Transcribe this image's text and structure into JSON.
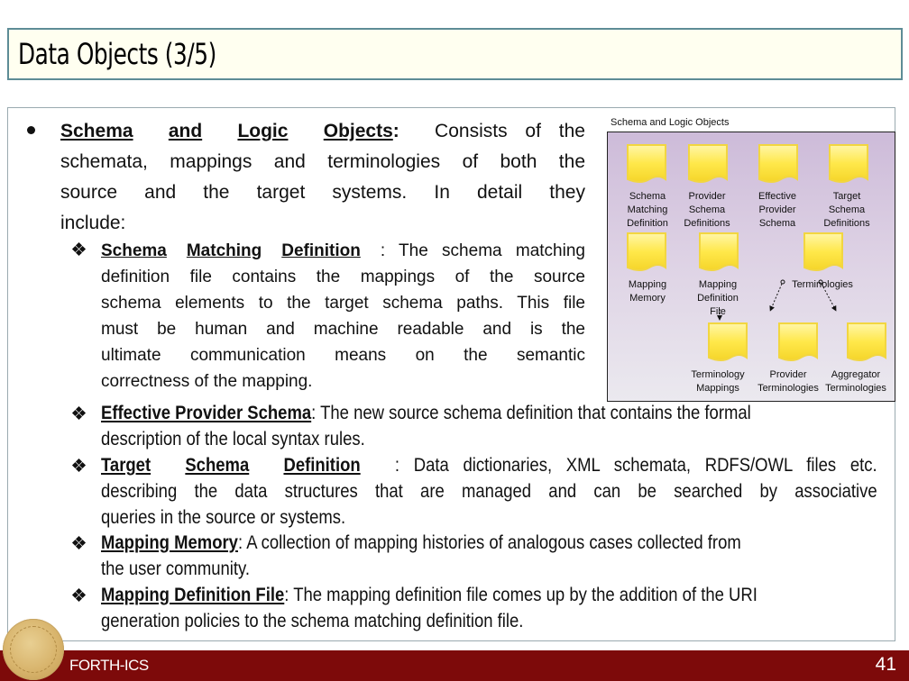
{
  "slide": {
    "title": "Data Objects (3/5)",
    "footer_org": "FORTH-ICS",
    "page_number": "41"
  },
  "main_bullet": {
    "term_words": [
      "Schema",
      "and",
      "Logic",
      "Objects"
    ],
    "colon": ":",
    "lines": [
      "Consists of the",
      "schemata, mappings and terminologies of both the",
      "source and the target systems. In detail they",
      "include:"
    ]
  },
  "sub_bullets": [
    {
      "term_words": [
        "Schema",
        "Matching",
        "Definition"
      ],
      "lines": [
        ": The schema matching",
        "definition file contains the mappings of the source",
        "schema elements to the target schema paths.  This file",
        "must be human and machine readable and is the",
        "ultimate communication means on the semantic",
        "correctness of the mapping."
      ]
    },
    {
      "term_words": [
        "Effective Provider Schema"
      ],
      "lines": [
        ": The new source schema definition that contains the formal",
        "description of the local syntax rules."
      ]
    },
    {
      "term_words": [
        "Target",
        "Schema",
        "Definition"
      ],
      "lines": [
        ": Data dictionaries, XML schemata, RDFS/OWL files etc.",
        "describing the data structures that are managed and can be searched by associative",
        "queries in the source or systems."
      ]
    },
    {
      "term_words": [
        "Mapping Memory"
      ],
      "lines": [
        ": A collection of mapping histories of analogous cases collected from",
        "the user community."
      ]
    },
    {
      "term_words": [
        "Mapping Definition File"
      ],
      "lines": [
        ": The mapping definition file comes up by the addition of the URI",
        "generation policies to the schema matching definition file."
      ]
    }
  ],
  "diagram": {
    "title": "Schema and Logic Objects",
    "doc_color": "#ffe84a",
    "nodes": [
      {
        "label": [
          "Schema",
          "Matching",
          "Definition"
        ]
      },
      {
        "label": [
          "Provider",
          "Schema",
          "Definitions"
        ]
      },
      {
        "label": [
          "Effective",
          "Provider",
          "Schema"
        ]
      },
      {
        "label": [
          "Target",
          "Schema",
          "Definitions"
        ]
      },
      {
        "label": [
          "Mapping",
          "Memory"
        ]
      },
      {
        "label": [
          "Mapping",
          "Definition",
          "File"
        ]
      },
      {
        "label": [
          "Terminologies"
        ]
      },
      {
        "label": [
          "Terminology",
          "Mappings"
        ]
      },
      {
        "label": [
          "Provider",
          "Terminologies"
        ]
      },
      {
        "label": [
          "Aggregator",
          "Terminologies"
        ]
      }
    ]
  },
  "colors": {
    "title_bg": "#fffff0",
    "title_border": "#5d8c96",
    "footer_bg": "#7d0a0a"
  }
}
